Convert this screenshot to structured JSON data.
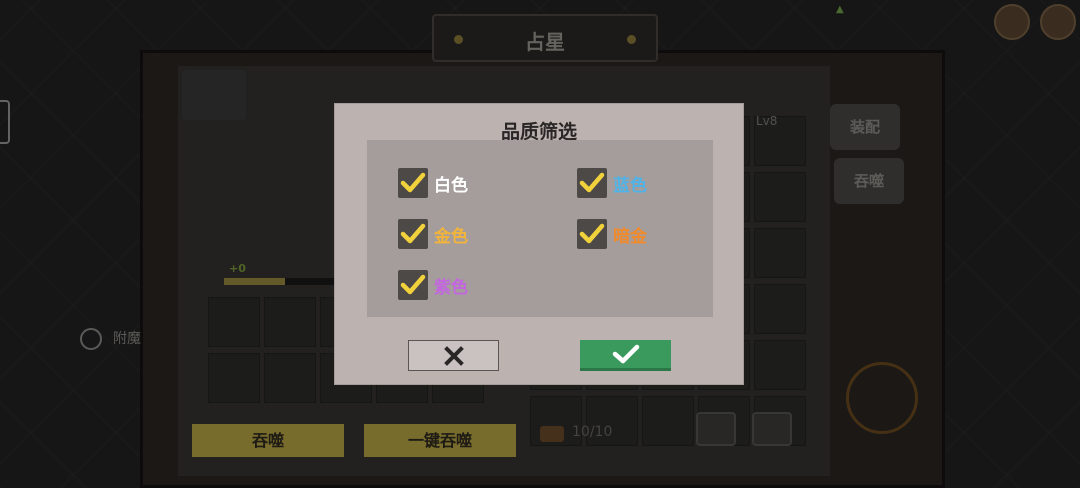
{
  "header": {
    "title": "占星"
  },
  "background": {
    "enchant_label": "附魔",
    "level_label": "Lv8",
    "plus_label": "+0",
    "progress_fraction": 0.55,
    "side_buttons": {
      "equip": "装配",
      "devour": "吞噬"
    },
    "bottom_buttons": {
      "devour": "吞噬",
      "one_click_devour": "一键吞噬"
    },
    "capacity": "10/10"
  },
  "dialog": {
    "title": "品质筛选",
    "options": [
      {
        "label": "白色",
        "checked": true,
        "color": "#ffffff"
      },
      {
        "label": "蓝色",
        "checked": true,
        "color": "#4fb3e8"
      },
      {
        "label": "金色",
        "checked": true,
        "color": "#f2b43a"
      },
      {
        "label": "暗金",
        "checked": true,
        "color": "#f08a2a"
      },
      {
        "label": "紫色",
        "checked": true,
        "color": "#c466e0"
      }
    ],
    "cancel_icon": "close-icon",
    "confirm_icon": "check-icon",
    "colors": {
      "check": "#f2d23c",
      "confirm": "#3a9a5e"
    }
  }
}
